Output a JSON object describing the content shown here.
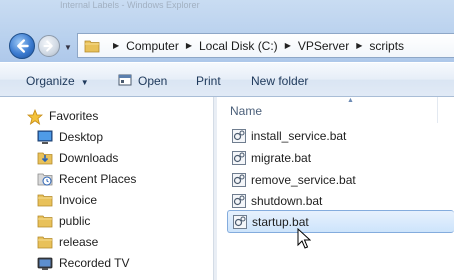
{
  "window": {
    "title_strip": "Internal Labels - Windows Explorer"
  },
  "address_bar": {
    "crumbs": [
      "Computer",
      "Local Disk (C:)",
      "VPServer",
      "scripts"
    ]
  },
  "command_bar": {
    "organize": "Organize",
    "open": "Open",
    "print": "Print",
    "new_folder": "New folder"
  },
  "nav_pane": {
    "favorites_label": "Favorites",
    "items": [
      {
        "label": "Desktop",
        "icon": "desktop-icon"
      },
      {
        "label": "Downloads",
        "icon": "downloads-folder-icon"
      },
      {
        "label": "Recent Places",
        "icon": "recent-places-icon"
      },
      {
        "label": "Invoice",
        "icon": "folder-icon"
      },
      {
        "label": "public",
        "icon": "folder-icon"
      },
      {
        "label": "release",
        "icon": "folder-icon"
      },
      {
        "label": "Recorded TV",
        "icon": "recorded-tv-icon"
      }
    ]
  },
  "content": {
    "column_name": "Name",
    "files": [
      {
        "label": "install_service.bat",
        "icon": "batch-file-icon",
        "selected": false
      },
      {
        "label": "migrate.bat",
        "icon": "batch-file-icon",
        "selected": false
      },
      {
        "label": "remove_service.bat",
        "icon": "batch-file-icon",
        "selected": false
      },
      {
        "label": "shutdown.bat",
        "icon": "batch-file-icon",
        "selected": false
      },
      {
        "label": "startup.bat",
        "icon": "batch-file-icon",
        "selected": true
      }
    ]
  },
  "colors": {
    "chrome": "#b9d1ee",
    "command_text": "#1e395b",
    "selection_fill": "#cde4fb",
    "selection_border": "#84acdd",
    "folder": "#e8c15a"
  }
}
